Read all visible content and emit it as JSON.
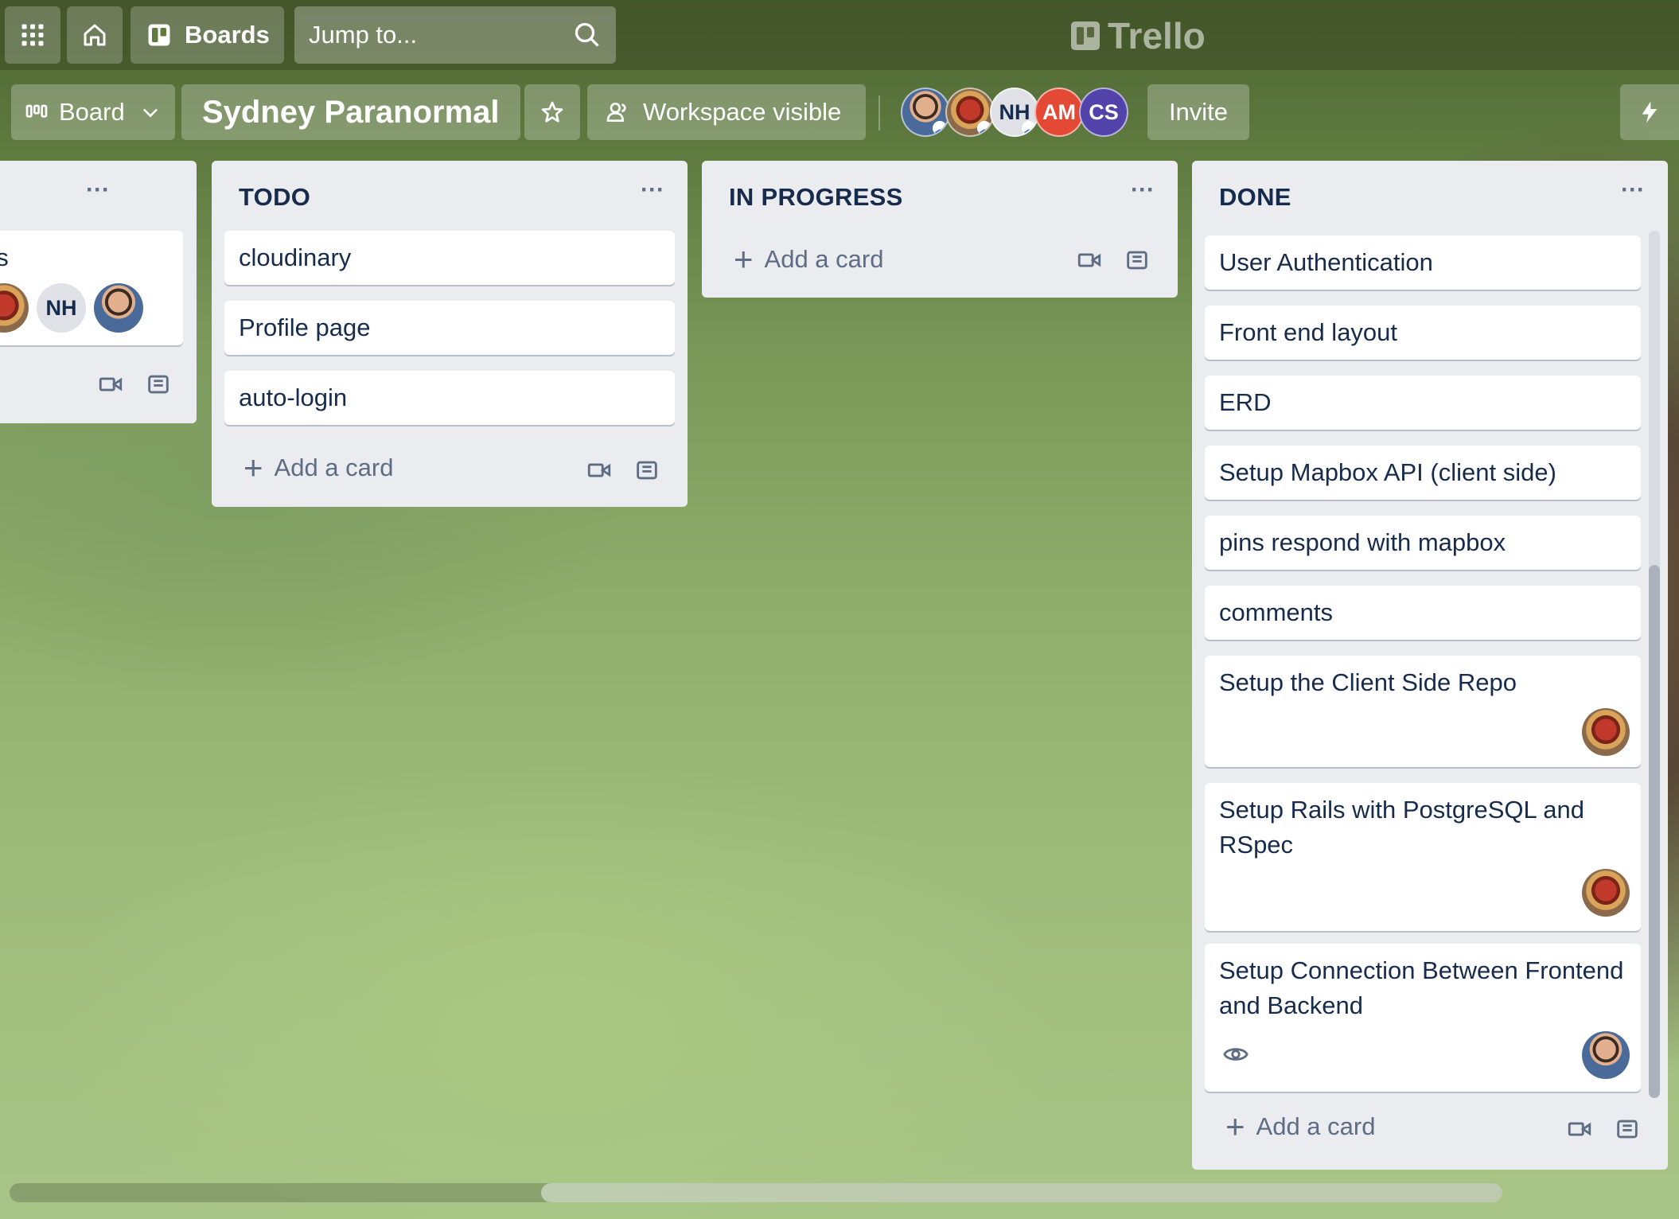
{
  "topbar": {
    "boards_label": "Boards",
    "search_placeholder": "Jump to...",
    "logo_text": "Trello"
  },
  "board_header": {
    "view_label": "Board",
    "title": "Sydney Paranormal",
    "visibility_label": "Workspace visible",
    "members": [
      {
        "initials": "",
        "kind": "photo"
      },
      {
        "initials": "",
        "kind": "cartoon"
      },
      {
        "initials": "NH",
        "kind": "initials"
      },
      {
        "initials": "AM",
        "kind": "initials"
      },
      {
        "initials": "CS",
        "kind": "initials"
      }
    ],
    "invite_label": "Invite"
  },
  "lists": {
    "partial": {
      "title": "",
      "card_text_fragment": "es",
      "card_member_initials": "NH"
    },
    "todo": {
      "title": "TODO",
      "cards": [
        "cloudinary",
        "Profile page",
        "auto-login"
      ],
      "add_card_label": "Add a card"
    },
    "in_progress": {
      "title": "IN PROGRESS",
      "cards": [],
      "add_card_label": "Add a card"
    },
    "done": {
      "title": "DONE",
      "cards": [
        "User Authentication",
        "Front end layout",
        "ERD",
        "Setup Mapbox API (client side)",
        "pins respond with mapbox",
        "comments",
        "Setup the Client Side Repo",
        "Setup Rails with PostgreSQL and RSpec",
        "Setup Connection Between Frontend and Backend"
      ],
      "add_card_label": "Add a card"
    }
  },
  "icons": {
    "menu": "...",
    "plus": "+"
  }
}
